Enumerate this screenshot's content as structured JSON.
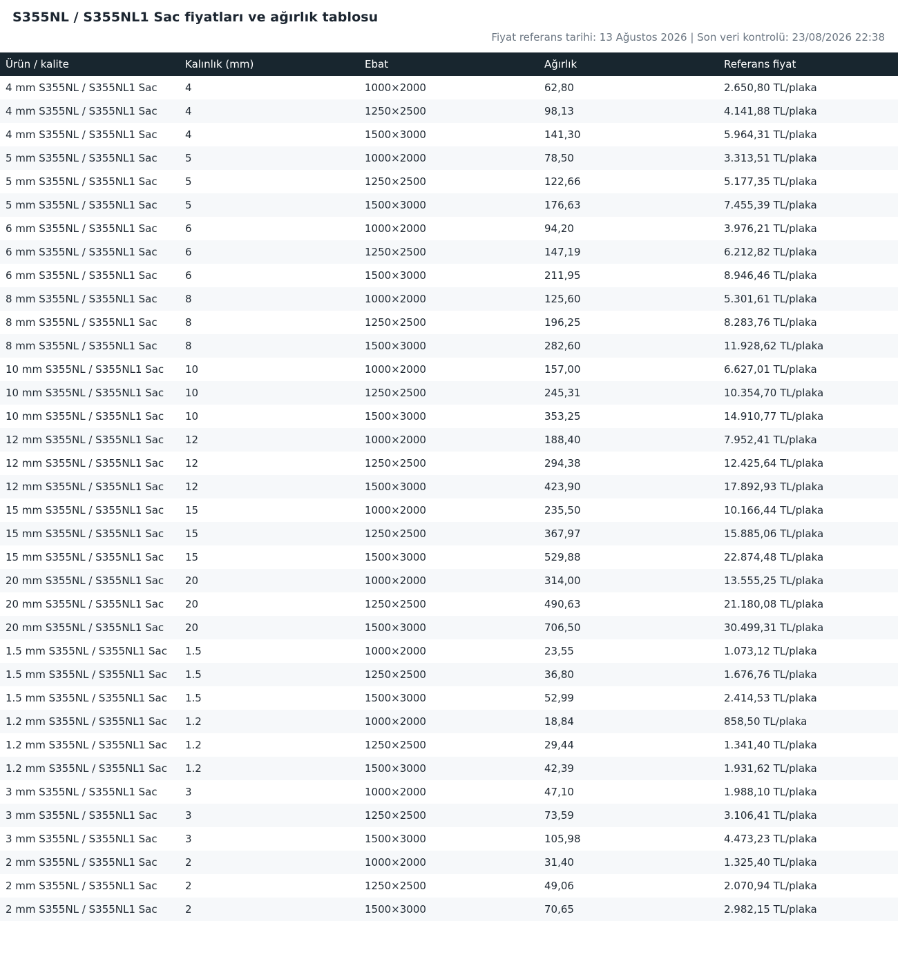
{
  "page": {
    "title": "S355NL / S355NL1 Sac fiyatları ve ağırlık tablosu",
    "meta": "Fiyat referans tarihi: 13 Ağustos 2026 | Son veri kontrolü: 23/08/2026 22:38"
  },
  "table": {
    "columns": [
      "Ürün / kalite",
      "Kalınlık (mm)",
      "Ebat",
      "Ağırlık",
      "Referans fiyat"
    ],
    "rows": [
      [
        "4 mm S355NL / S355NL1 Sac",
        "4",
        "1000×2000",
        "62,80",
        "2.650,80 TL/plaka"
      ],
      [
        "4 mm S355NL / S355NL1 Sac",
        "4",
        "1250×2500",
        "98,13",
        "4.141,88 TL/plaka"
      ],
      [
        "4 mm S355NL / S355NL1 Sac",
        "4",
        "1500×3000",
        "141,30",
        "5.964,31 TL/plaka"
      ],
      [
        "5 mm S355NL / S355NL1 Sac",
        "5",
        "1000×2000",
        "78,50",
        "3.313,51 TL/plaka"
      ],
      [
        "5 mm S355NL / S355NL1 Sac",
        "5",
        "1250×2500",
        "122,66",
        "5.177,35 TL/plaka"
      ],
      [
        "5 mm S355NL / S355NL1 Sac",
        "5",
        "1500×3000",
        "176,63",
        "7.455,39 TL/plaka"
      ],
      [
        "6 mm S355NL / S355NL1 Sac",
        "6",
        "1000×2000",
        "94,20",
        "3.976,21 TL/plaka"
      ],
      [
        "6 mm S355NL / S355NL1 Sac",
        "6",
        "1250×2500",
        "147,19",
        "6.212,82 TL/plaka"
      ],
      [
        "6 mm S355NL / S355NL1 Sac",
        "6",
        "1500×3000",
        "211,95",
        "8.946,46 TL/plaka"
      ],
      [
        "8 mm S355NL / S355NL1 Sac",
        "8",
        "1000×2000",
        "125,60",
        "5.301,61 TL/plaka"
      ],
      [
        "8 mm S355NL / S355NL1 Sac",
        "8",
        "1250×2500",
        "196,25",
        "8.283,76 TL/plaka"
      ],
      [
        "8 mm S355NL / S355NL1 Sac",
        "8",
        "1500×3000",
        "282,60",
        "11.928,62 TL/plaka"
      ],
      [
        "10 mm S355NL / S355NL1 Sac",
        "10",
        "1000×2000",
        "157,00",
        "6.627,01 TL/plaka"
      ],
      [
        "10 mm S355NL / S355NL1 Sac",
        "10",
        "1250×2500",
        "245,31",
        "10.354,70 TL/plaka"
      ],
      [
        "10 mm S355NL / S355NL1 Sac",
        "10",
        "1500×3000",
        "353,25",
        "14.910,77 TL/plaka"
      ],
      [
        "12 mm S355NL / S355NL1 Sac",
        "12",
        "1000×2000",
        "188,40",
        "7.952,41 TL/plaka"
      ],
      [
        "12 mm S355NL / S355NL1 Sac",
        "12",
        "1250×2500",
        "294,38",
        "12.425,64 TL/plaka"
      ],
      [
        "12 mm S355NL / S355NL1 Sac",
        "12",
        "1500×3000",
        "423,90",
        "17.892,93 TL/plaka"
      ],
      [
        "15 mm S355NL / S355NL1 Sac",
        "15",
        "1000×2000",
        "235,50",
        "10.166,44 TL/plaka"
      ],
      [
        "15 mm S355NL / S355NL1 Sac",
        "15",
        "1250×2500",
        "367,97",
        "15.885,06 TL/plaka"
      ],
      [
        "15 mm S355NL / S355NL1 Sac",
        "15",
        "1500×3000",
        "529,88",
        "22.874,48 TL/plaka"
      ],
      [
        "20 mm S355NL / S355NL1 Sac",
        "20",
        "1000×2000",
        "314,00",
        "13.555,25 TL/plaka"
      ],
      [
        "20 mm S355NL / S355NL1 Sac",
        "20",
        "1250×2500",
        "490,63",
        "21.180,08 TL/plaka"
      ],
      [
        "20 mm S355NL / S355NL1 Sac",
        "20",
        "1500×3000",
        "706,50",
        "30.499,31 TL/plaka"
      ],
      [
        "1.5 mm S355NL / S355NL1 Sac",
        "1.5",
        "1000×2000",
        "23,55",
        "1.073,12 TL/plaka"
      ],
      [
        "1.5 mm S355NL / S355NL1 Sac",
        "1.5",
        "1250×2500",
        "36,80",
        "1.676,76 TL/plaka"
      ],
      [
        "1.5 mm S355NL / S355NL1 Sac",
        "1.5",
        "1500×3000",
        "52,99",
        "2.414,53 TL/plaka"
      ],
      [
        "1.2 mm S355NL / S355NL1 Sac",
        "1.2",
        "1000×2000",
        "18,84",
        "858,50 TL/plaka"
      ],
      [
        "1.2 mm S355NL / S355NL1 Sac",
        "1.2",
        "1250×2500",
        "29,44",
        "1.341,40 TL/plaka"
      ],
      [
        "1.2 mm S355NL / S355NL1 Sac",
        "1.2",
        "1500×3000",
        "42,39",
        "1.931,62 TL/plaka"
      ],
      [
        "3 mm S355NL / S355NL1 Sac",
        "3",
        "1000×2000",
        "47,10",
        "1.988,10 TL/plaka"
      ],
      [
        "3 mm S355NL / S355NL1 Sac",
        "3",
        "1250×2500",
        "73,59",
        "3.106,41 TL/plaka"
      ],
      [
        "3 mm S355NL / S355NL1 Sac",
        "3",
        "1500×3000",
        "105,98",
        "4.473,23 TL/plaka"
      ],
      [
        "2 mm S355NL / S355NL1 Sac",
        "2",
        "1000×2000",
        "31,40",
        "1.325,40 TL/plaka"
      ],
      [
        "2 mm S355NL / S355NL1 Sac",
        "2",
        "1250×2500",
        "49,06",
        "2.070,94 TL/plaka"
      ],
      [
        "2 mm S355NL / S355NL1 Sac",
        "2",
        "1500×3000",
        "70,65",
        "2.982,15 TL/plaka"
      ]
    ]
  },
  "colors": {
    "header_background": "#18262f",
    "header_text": "#ffffff",
    "stripe": "#f6f8fa",
    "meta_text": "#6b7682"
  }
}
